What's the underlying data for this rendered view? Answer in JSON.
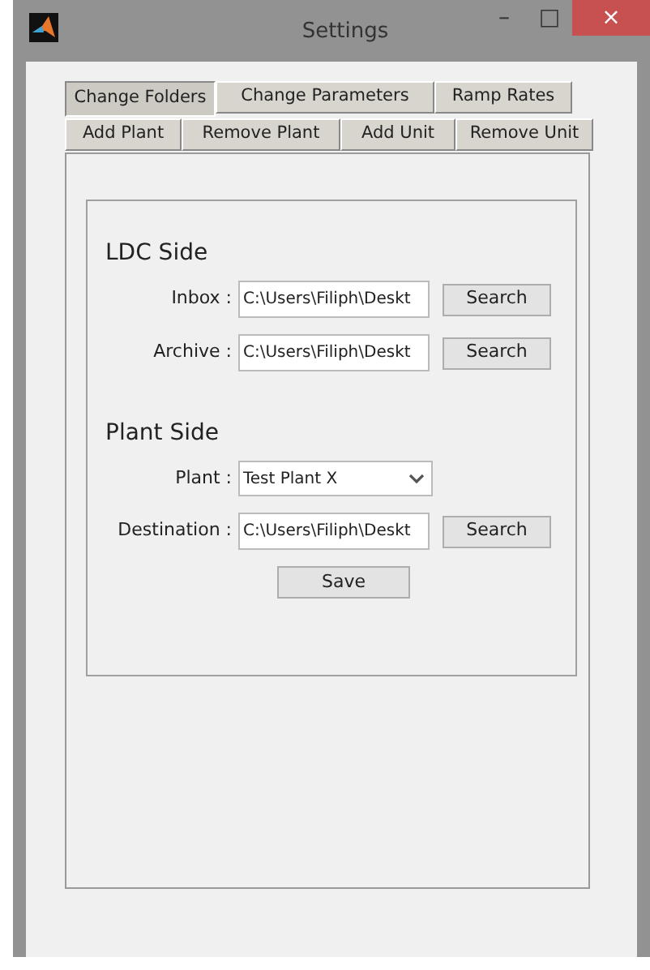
{
  "window": {
    "title": "Settings",
    "controls": [
      "–",
      "□",
      "×"
    ]
  },
  "tabs": [
    [
      {
        "label": "Change Folders",
        "selected": true
      },
      {
        "label": "Change Parameters",
        "selected": false
      },
      {
        "label": "Ramp Rates",
        "selected": false
      }
    ],
    [
      {
        "label": "Add Plant",
        "selected": false
      },
      {
        "label": "Remove Plant",
        "selected": false
      },
      {
        "label": "Add Unit",
        "selected": false
      },
      {
        "label": "Remove Unit",
        "selected": false
      }
    ]
  ],
  "sections": [
    {
      "heading": "LDC Side",
      "rows": [
        {
          "kind": "path",
          "label": "Inbox :",
          "value": "C:\\Users\\Filiph\\Deskt",
          "button": "Search"
        },
        {
          "kind": "path",
          "label": "Archive :",
          "value": "C:\\Users\\Filiph\\Deskt",
          "button": "Search"
        }
      ]
    },
    {
      "heading": "Plant Side",
      "rows": [
        {
          "kind": "dropdown",
          "label": "Plant :",
          "value": "Test Plant X"
        },
        {
          "kind": "path",
          "label": "Destination :",
          "value": "C:\\Users\\Filiph\\Deskt",
          "button": "Search"
        }
      ]
    }
  ],
  "save_button": "Save"
}
